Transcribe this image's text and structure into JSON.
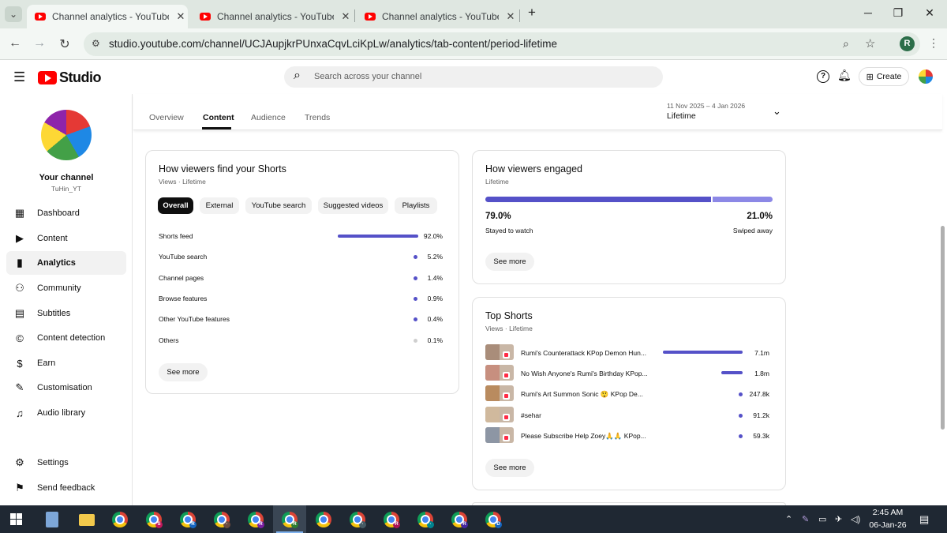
{
  "browser": {
    "tabs": [
      {
        "title": "Channel analytics - YouTube Studio"
      },
      {
        "title": "Channel analytics - YouTube Studio"
      },
      {
        "title": "Channel analytics - YouTube Studio"
      }
    ],
    "url": "studio.youtube.com/channel/UCJAupjkrPUnxaCqvLciKpLw/analytics/tab-content/period-lifetime",
    "profile_initial": "R"
  },
  "header": {
    "logo_text": "Studio",
    "search_placeholder": "Search across your channel",
    "create_label": "Create"
  },
  "sidebar": {
    "channel_name": "Your channel",
    "channel_handle": "TuHin_YT",
    "items": [
      {
        "label": "Dashboard",
        "icon": "dashboard-icon"
      },
      {
        "label": "Content",
        "icon": "content-icon"
      },
      {
        "label": "Analytics",
        "icon": "analytics-icon",
        "selected": true
      },
      {
        "label": "Community",
        "icon": "community-icon"
      },
      {
        "label": "Subtitles",
        "icon": "subtitles-icon"
      },
      {
        "label": "Content detection",
        "icon": "copyright-icon"
      },
      {
        "label": "Earn",
        "icon": "dollar-icon"
      },
      {
        "label": "Customisation",
        "icon": "magic-wand-icon"
      },
      {
        "label": "Audio library",
        "icon": "audio-library-icon"
      }
    ],
    "footer": [
      {
        "label": "Settings",
        "icon": "gear-icon"
      },
      {
        "label": "Send feedback",
        "icon": "feedback-icon"
      }
    ]
  },
  "content_tabs": [
    "Overview",
    "Content",
    "Audience",
    "Trends"
  ],
  "content_tab_selected": "Content",
  "period": {
    "range": "11 Nov 2025 – 4 Jan 2026",
    "label": "Lifetime"
  },
  "find_card": {
    "title": "How viewers find your Shorts",
    "subtitle": "Views · Lifetime",
    "chips": [
      "Overall",
      "External",
      "YouTube search",
      "Suggested videos",
      "Playlists"
    ],
    "selected_chip": "Overall",
    "rows": [
      {
        "label": "Shorts feed",
        "value": "92.0%",
        "fraction": 0.92
      },
      {
        "label": "YouTube search",
        "value": "5.2%",
        "fraction": 0.052
      },
      {
        "label": "Channel pages",
        "value": "1.4%",
        "fraction": 0.014
      },
      {
        "label": "Browse features",
        "value": "0.9%",
        "fraction": 0.009
      },
      {
        "label": "Other YouTube features",
        "value": "0.4%",
        "fraction": 0.004
      },
      {
        "label": "Others",
        "value": "0.1%",
        "fraction": 0.001
      }
    ],
    "see_more": "See more"
  },
  "engaged_card": {
    "title": "How viewers engaged",
    "subtitle": "Lifetime",
    "stayed_value": "79.0%",
    "stayed_label": "Stayed to watch",
    "swiped_value": "21.0%",
    "swiped_label": "Swiped away",
    "stayed_fraction": 0.79,
    "see_more": "See more"
  },
  "top_shorts": {
    "title": "Top Shorts",
    "subtitle": "Views · Lifetime",
    "items": [
      {
        "title": "Rumi's Counterattack KPop Demon Hun...",
        "views": "7.1m",
        "fraction": 1.0
      },
      {
        "title": "No Wish Anyone's Rumi's Birthday KPop...",
        "views": "1.8m",
        "fraction": 0.25
      },
      {
        "title": "Rumi's Art Summon Sonic 😲 KPop De...",
        "views": "247.8k",
        "fraction": 0.035
      },
      {
        "title": "#sehar",
        "views": "91.2k",
        "fraction": 0.013
      },
      {
        "title": "Please Subscribe Help Zoey🙏🙏 KPop...",
        "views": "59.3k",
        "fraction": 0.008
      }
    ],
    "see_more": "See more"
  },
  "taskbar": {
    "time": "2:45 AM",
    "date": "06-Jan-26"
  },
  "colors": {
    "accent": "#5551c8",
    "accent_light": "#8c88e6",
    "youtube_red": "#ff0000"
  }
}
